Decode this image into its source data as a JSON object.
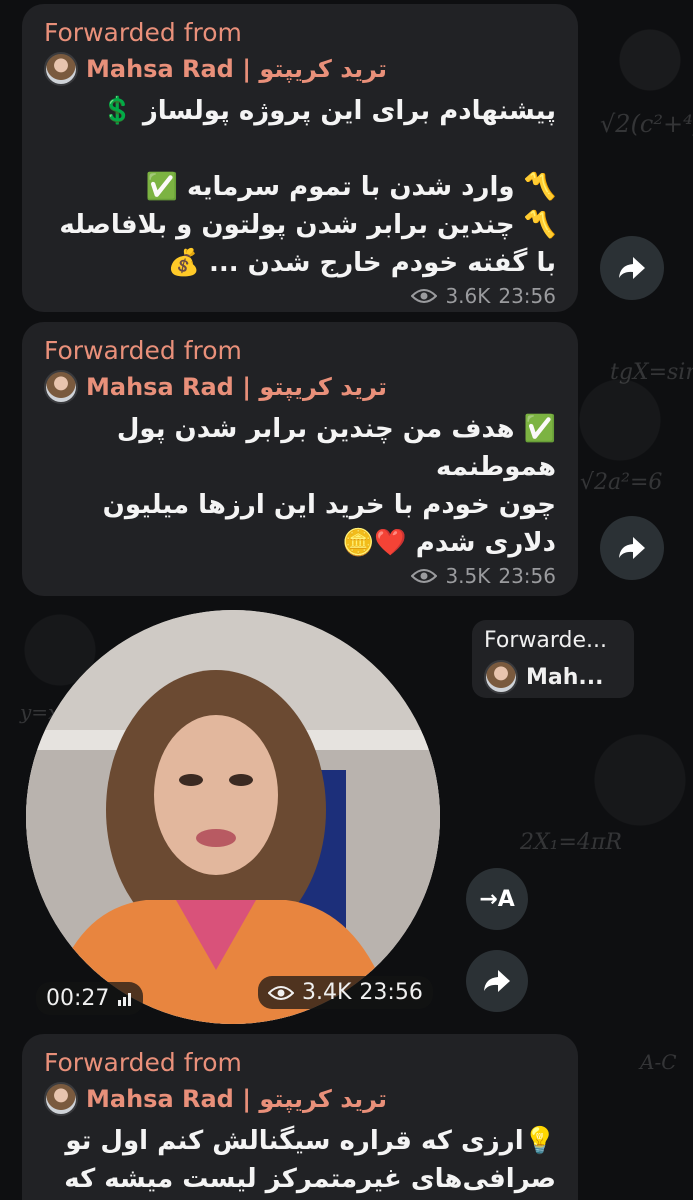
{
  "messages": [
    {
      "forwarded_label": "Forwarded from",
      "source": "Mahsa Rad | ترید کریپتو",
      "text": "پیشنهادم برای این پروژه پولساز 💲\n\n〽️ وارد شدن با تموم سرمایه ✅\n〽️ چندین برابر شدن پولتون و بلافاصله با گفته خودم خارج شدن ... 💰",
      "views": "3.6K",
      "time": "23:56"
    },
    {
      "forwarded_label": "Forwarded from",
      "source": "Mahsa Rad | ترید کریپتو",
      "text": "✅ هدف من چندین برابر شدن پول هموطنمه\nچون خودم با خرید این ارزها میلیون دلاری شدم ❤️🪙",
      "views": "3.5K",
      "time": "23:56"
    },
    {
      "forwarded_label": "Forwarded from",
      "source": "Mahsa Rad | ترید کریپتو",
      "text": "💡ارزی که قراره سیگنالش کنم اول تو صرافی‌های غیرمتمرکز لیست میشه که یکی",
      "views": "",
      "time": ""
    }
  ],
  "video_message": {
    "forwarded_label": "Forwarde...",
    "source": "Mah...",
    "duration": "00:27",
    "views": "3.4K",
    "time": "23:56",
    "translate_label": "→A"
  },
  "colors": {
    "accent": "#e9907a",
    "bubble": "#212225",
    "background": "#0e0f11"
  }
}
